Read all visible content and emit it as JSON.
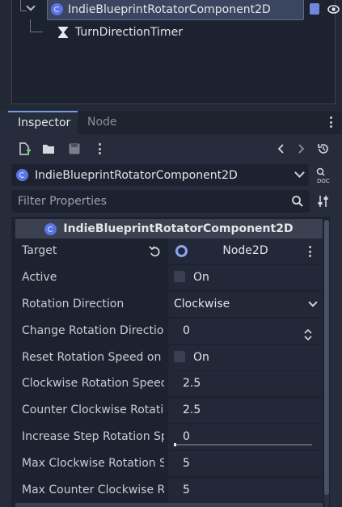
{
  "scene_tree": {
    "selected_node": "IndieBlueprintRotatorComponent2D",
    "child_node": "TurnDirectionTimer"
  },
  "tabs": [
    {
      "label": "Inspector",
      "active": true
    },
    {
      "label": "Node",
      "active": false
    }
  ],
  "object_selector": {
    "label": "IndieBlueprintRotatorComponent2D"
  },
  "filter": {
    "placeholder": "Filter Properties"
  },
  "section": {
    "title": "IndieBlueprintRotatorComponent2D"
  },
  "properties": {
    "target": {
      "label": "Target",
      "value": "Node2D"
    },
    "active": {
      "label": "Active",
      "value": "On",
      "checked": false
    },
    "rotation_direction": {
      "label": "Rotation Direction",
      "value": "Clockwise"
    },
    "change_rotation_direction": {
      "label": "Change Rotation Direction",
      "value": "0"
    },
    "reset_rotation_speed": {
      "label": "Reset Rotation Speed on T",
      "value": "On",
      "checked": false
    },
    "clockwise_rotation_speed": {
      "label": "Clockwise Rotation Speed",
      "value": "2.5"
    },
    "counter_clockwise_rotation": {
      "label": "Counter Clockwise Rotatio",
      "value": "2.5"
    },
    "increase_step_rotation": {
      "label": "Increase Step Rotation Spe",
      "value": "0"
    },
    "max_clockwise_rotation": {
      "label": "Max Clockwise Rotation Sp",
      "value": "5"
    },
    "max_counter_clockwise": {
      "label": "Max Counter Clockwise Ro",
      "value": "5"
    }
  },
  "colors": {
    "accent": "#6e9ae6",
    "node_icon": "#5b74e8",
    "panel_bg": "#262c3b"
  }
}
